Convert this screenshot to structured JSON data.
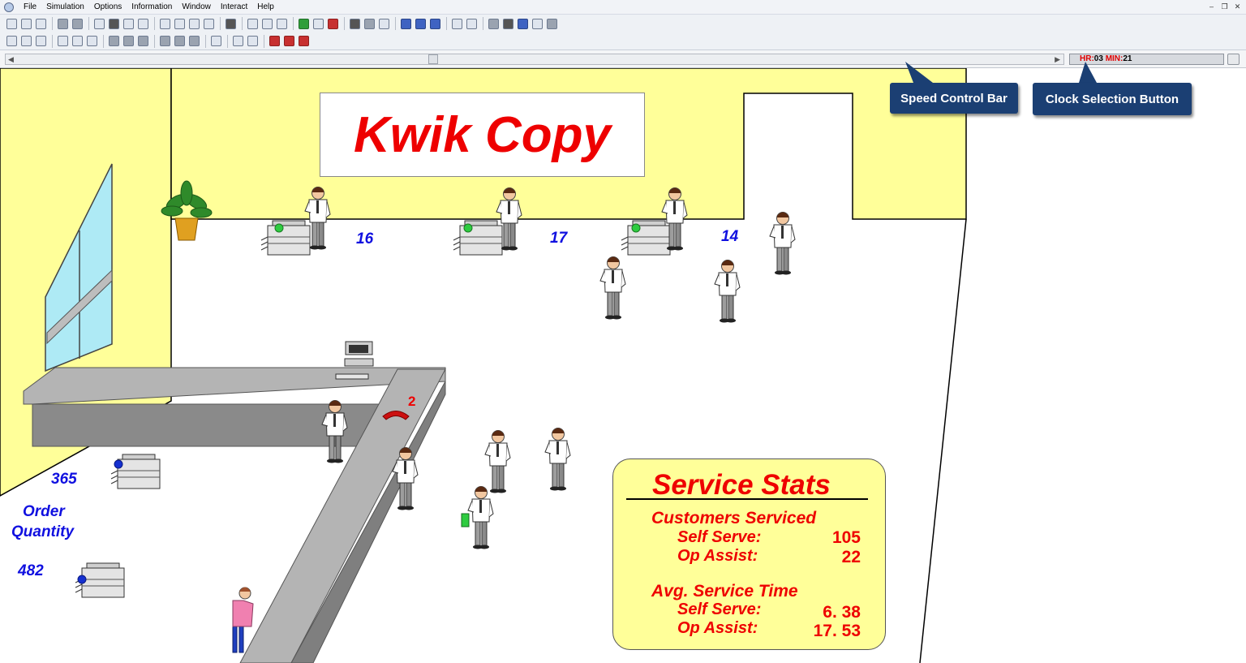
{
  "menubar": {
    "items": [
      "File",
      "Simulation",
      "Options",
      "Information",
      "Window",
      "Interact",
      "Help"
    ]
  },
  "speed_bar": {
    "clock": {
      "hr_label": "HR:",
      "hr_value": "03",
      "min_label": "MIN:",
      "min_value": "21"
    }
  },
  "callouts": {
    "speed_control": "Speed Control Bar",
    "clock_selection": "Clock Selection Button"
  },
  "scene": {
    "sign_title": "Kwik Copy",
    "copier_counts": [
      "16",
      "17",
      "14"
    ],
    "counter_count_top": "365",
    "order_label_line1": "Order",
    "order_label_line2": "Quantity",
    "counter_count_bottom": "482",
    "phone_count": "2"
  },
  "service_stats": {
    "title": "Service Stats",
    "customers_serviced_heading": "Customers Serviced",
    "self_serve_label": "Self Serve:",
    "self_serve_count": "105",
    "op_assist_label": "Op Assist:",
    "op_assist_count": "22",
    "avg_time_heading": "Avg. Service Time",
    "avg_self_serve_label": "Self Serve:",
    "avg_self_serve_value": "6. 38",
    "avg_op_assist_label": "Op Assist:",
    "avg_op_assist_value": "17. 53"
  },
  "colors": {
    "wall": "#ffff99",
    "sign_text": "#ee0000",
    "counts_blue": "#1010e0",
    "callout": "#1b3f73",
    "counter_gray": "#b4b4b4"
  }
}
